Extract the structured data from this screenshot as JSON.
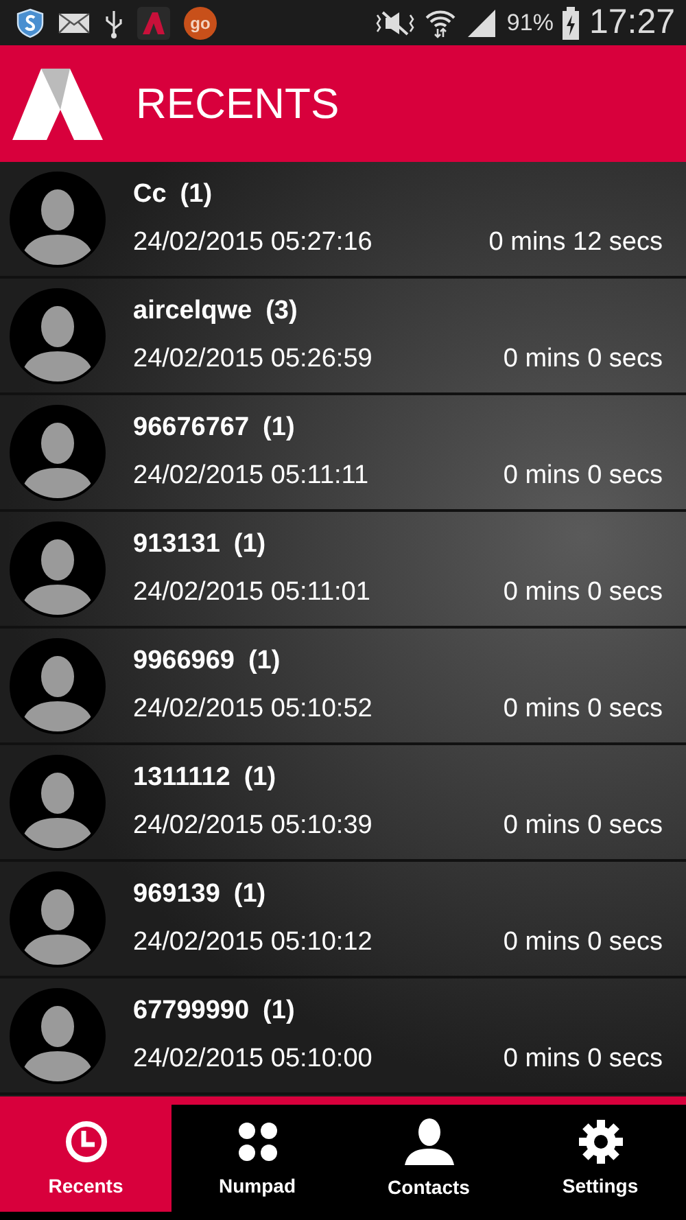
{
  "status_bar": {
    "app_badge": "go",
    "battery": "91%",
    "time": "17:27"
  },
  "header": {
    "title": "RECENTS"
  },
  "calls": [
    {
      "name": "Cc",
      "count": "(1)",
      "datetime": "24/02/2015 05:27:16",
      "duration": "0 mins 12 secs"
    },
    {
      "name": "aircelqwe",
      "count": "(3)",
      "datetime": "24/02/2015 05:26:59",
      "duration": "0 mins 0 secs"
    },
    {
      "name": "96676767",
      "count": "(1)",
      "datetime": "24/02/2015 05:11:11",
      "duration": "0 mins 0 secs"
    },
    {
      "name": "913131",
      "count": "(1)",
      "datetime": "24/02/2015 05:11:01",
      "duration": "0 mins 0 secs"
    },
    {
      "name": "9966969",
      "count": "(1)",
      "datetime": "24/02/2015 05:10:52",
      "duration": "0 mins 0 secs"
    },
    {
      "name": "1311112",
      "count": "(1)",
      "datetime": "24/02/2015 05:10:39",
      "duration": "0 mins 0 secs"
    },
    {
      "name": "969139",
      "count": "(1)",
      "datetime": "24/02/2015 05:10:12",
      "duration": "0 mins 0 secs"
    },
    {
      "name": "67799990",
      "count": "(1)",
      "datetime": "24/02/2015 05:10:00",
      "duration": "0 mins 0 secs"
    }
  ],
  "tabs": [
    {
      "label": "Recents",
      "kind": "clock",
      "selected": true
    },
    {
      "label": "Numpad",
      "kind": "dots",
      "selected": false
    },
    {
      "label": "Contacts",
      "kind": "person",
      "selected": false
    },
    {
      "label": "Settings",
      "kind": "gear",
      "selected": false
    }
  ]
}
